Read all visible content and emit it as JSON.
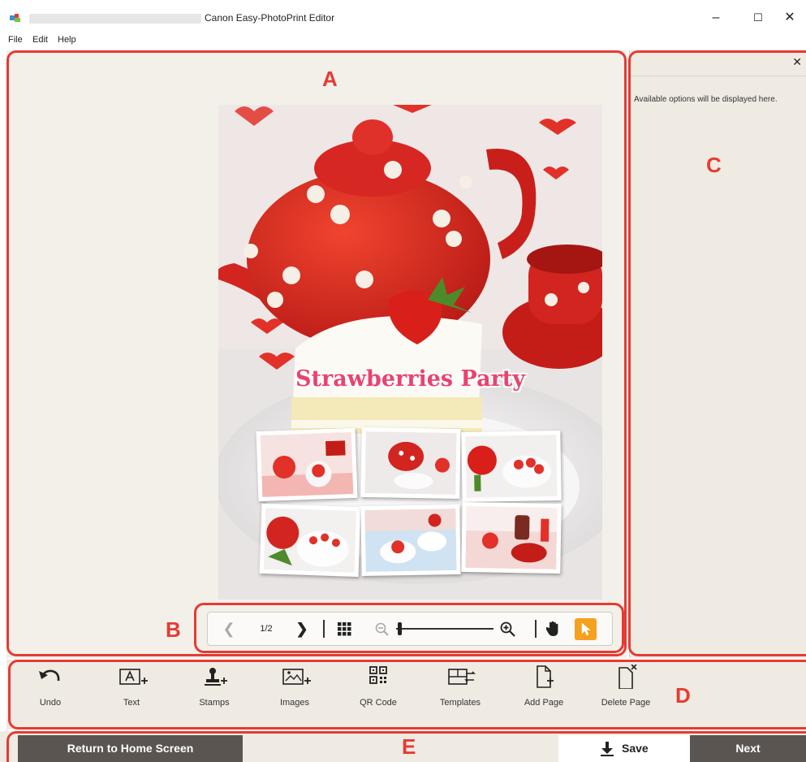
{
  "window": {
    "title": "Canon Easy-PhotoPrint Editor",
    "controls": {
      "minimize": "–",
      "maximize": "☐",
      "close": "✕"
    }
  },
  "menu": [
    "File",
    "Edit",
    "Help"
  ],
  "editing_area": {
    "page_title": "Strawberries Party",
    "theme_colors": {
      "primary": "#e23128",
      "title": "#e8446e"
    }
  },
  "page_toolbar": {
    "page_indicator": "1/2",
    "prev": "❮",
    "next": "❯",
    "zoom_level": 0.03
  },
  "options_panel": {
    "close": "✕",
    "message": "Available options will be displayed here."
  },
  "tools": [
    {
      "icon": "undo-icon",
      "label": "Undo"
    },
    {
      "icon": "text-icon",
      "label": "Text"
    },
    {
      "icon": "stamps-icon",
      "label": "Stamps"
    },
    {
      "icon": "images-icon",
      "label": "Images"
    },
    {
      "icon": "qr-code-icon",
      "label": "QR Code"
    },
    {
      "icon": "templates-icon",
      "label": "Templates"
    },
    {
      "icon": "add-page-icon",
      "label": "Add Page"
    },
    {
      "icon": "delete-page-icon",
      "label": "Delete Page"
    }
  ],
  "footer": {
    "home": "Return to Home Screen",
    "save": "Save",
    "next": "Next"
  },
  "callouts": {
    "a": "A",
    "b": "B",
    "c": "C",
    "d": "D",
    "e": "E"
  },
  "colors": {
    "annotation": "#e53b33",
    "accent": "#f5a01f",
    "dark_button": "#5a5550"
  }
}
